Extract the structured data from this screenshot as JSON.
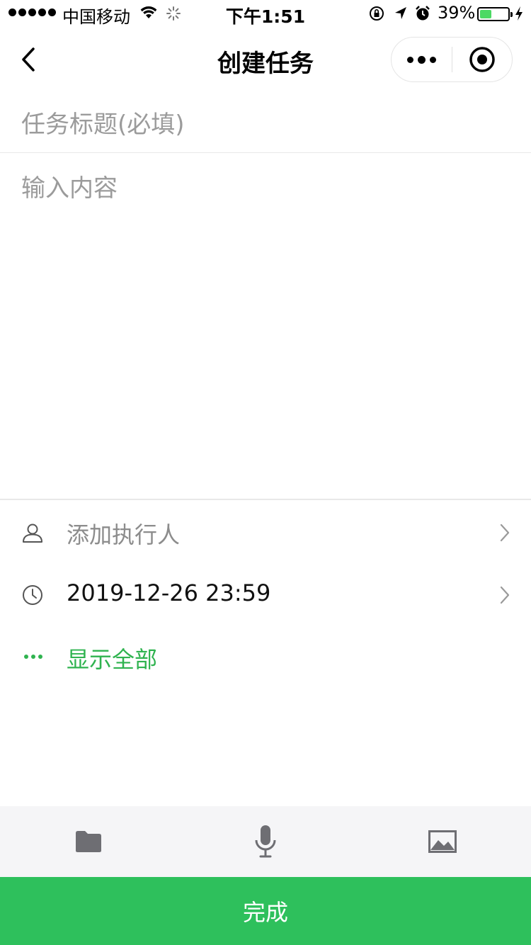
{
  "status_bar": {
    "carrier": "中国移动",
    "time": "下午1:51",
    "battery_percent": "39%",
    "battery_level": 0.39
  },
  "nav": {
    "title": "创建任务",
    "back_icon": "chevron-left-icon",
    "more_icon": "more-dots-icon",
    "close_icon": "target-circle-icon"
  },
  "form": {
    "title_placeholder": "任务标题(必填)",
    "content_placeholder": "输入内容",
    "assignee_label": "添加执行人",
    "deadline_value": "2019-12-26 23:59",
    "show_all_label": "显示全部"
  },
  "toolbar": {
    "tools": [
      "folder-icon",
      "microphone-icon",
      "image-icon"
    ]
  },
  "footer": {
    "done_label": "完成"
  },
  "colors": {
    "accent": "#2ec05c",
    "link_green": "#2fb34f",
    "placeholder": "#9b9b9b",
    "toolbar_bg": "#f5f5f7"
  }
}
